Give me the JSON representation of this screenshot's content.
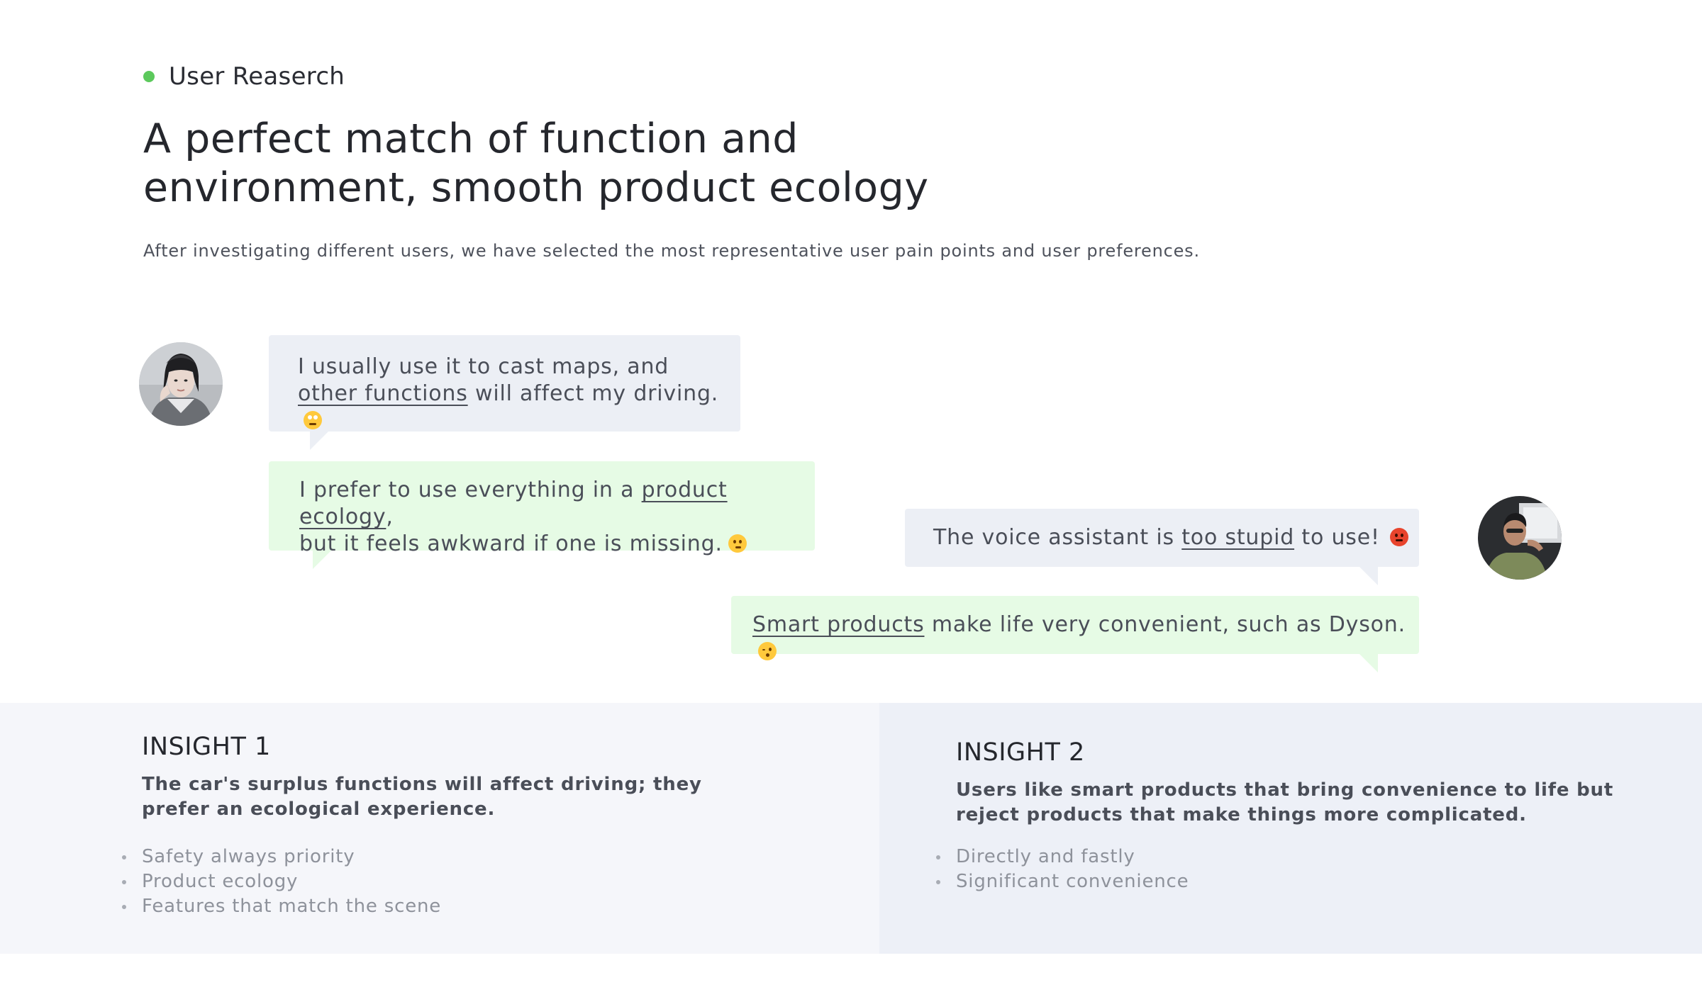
{
  "section": {
    "label": "User Reaserch",
    "dot_color": "#5cc95c"
  },
  "headline": {
    "line1": "A perfect match of function and",
    "line2": "environment, smooth product ecology"
  },
  "subtitle": "After investigating different users, we have selected the most representative user pain points and user preferences.",
  "quotes": [
    {
      "style": "gray",
      "line1": "I usually use it to cast maps, and",
      "highlight": "other functions",
      "rest": " will affect my driving.",
      "emoji": "rolling-eyes-emoji"
    },
    {
      "style": "green",
      "pre": "I prefer to use everything in a ",
      "highlight": "product ecology",
      "post": ",",
      "line2": "but it feels awkward if one is missing.",
      "emoji": "thinking-emoji"
    },
    {
      "style": "gray",
      "pre": "The voice assistant is ",
      "highlight": "too stupid",
      "post": " to use!",
      "emoji": "angry-emoji"
    },
    {
      "style": "green",
      "highlight": "Smart products",
      "post": " make life very convenient, such as Dyson.",
      "emoji": "kissing-wink-emoji"
    }
  ],
  "insights": [
    {
      "title": "INSIGHT 1",
      "description": "The car's surplus functions will affect driving; they prefer an ecological experience.",
      "points": [
        "Safety always priority",
        "Product ecology",
        "Features that match the scene"
      ]
    },
    {
      "title": "INSIGHT 2",
      "description": "Users like smart products that bring convenience to life but reject products that make things more complicated.",
      "points": [
        "Directly and fastly",
        "Significant convenience"
      ]
    }
  ],
  "colors": {
    "bubble_gray": "#eceff5",
    "bubble_green": "#e6fbe5",
    "insight_1_bg": "#f5f6fa",
    "insight_2_bg": "#edf0f7"
  }
}
